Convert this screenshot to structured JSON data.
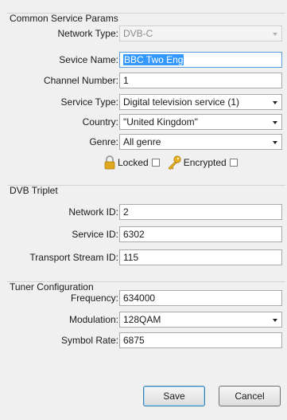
{
  "common": {
    "title": "Common Service Params",
    "network_type": {
      "label": "Network Type:",
      "value": "DVB-C"
    },
    "service_name": {
      "label": "Sevice Name:",
      "value": "BBC Two Eng"
    },
    "channel_number": {
      "label": "Channel Number:",
      "value": "1"
    },
    "service_type": {
      "label": "Service Type:",
      "value": "Digital television service (1)"
    },
    "country": {
      "label": "Country:",
      "value": "\"United Kingdom\""
    },
    "genre": {
      "label": "Genre:",
      "value": "All genre"
    },
    "locked": {
      "label": "Locked",
      "checked": false
    },
    "encrypted": {
      "label": "Encrypted",
      "checked": false
    }
  },
  "triplet": {
    "title": "DVB Triplet",
    "network_id": {
      "label": "Network ID:",
      "value": "2"
    },
    "service_id": {
      "label": "Service ID:",
      "value": "6302"
    },
    "transport_stream_id": {
      "label": "Transport Stream ID:",
      "value": "115"
    }
  },
  "tuner": {
    "title": "Tuner Configuration",
    "frequency": {
      "label": "Frequency:",
      "value": "634000"
    },
    "modulation": {
      "label": "Modulation:",
      "value": "128QAM"
    },
    "symbol_rate": {
      "label": "Symbol Rate:",
      "value": "6875"
    }
  },
  "buttons": {
    "save": "Save",
    "cancel": "Cancel"
  },
  "colors": {
    "selection": "#3399ff",
    "lock_icon": "#e0a81e",
    "key_icon": "#e8b020"
  }
}
